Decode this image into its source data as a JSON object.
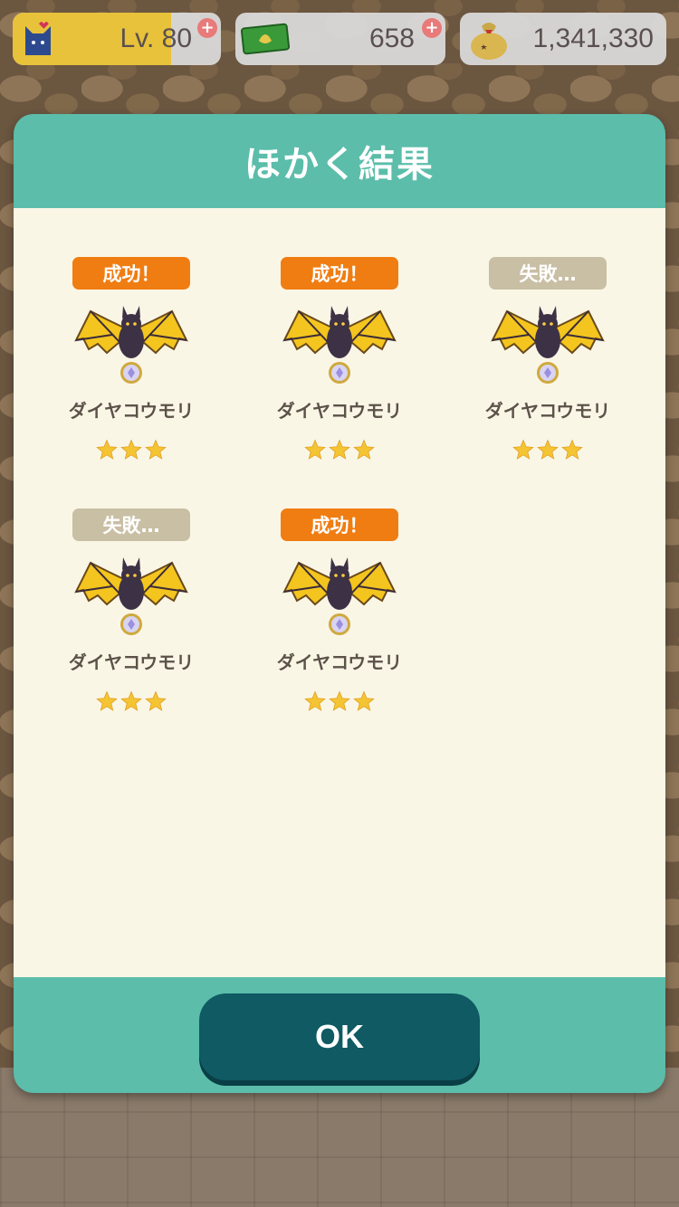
{
  "hud": {
    "level_label": "Lv. 80",
    "level_progress": 0.76,
    "tickets": "658",
    "bells": "1,341,330"
  },
  "dialog": {
    "title": "ほかく結果",
    "items": [
      {
        "result": "成功！",
        "status": "success",
        "name": "ダイヤコウモリ",
        "stars": 3
      },
      {
        "result": "成功！",
        "status": "success",
        "name": "ダイヤコウモリ",
        "stars": 3
      },
      {
        "result": "失敗…",
        "status": "failure",
        "name": "ダイヤコウモリ",
        "stars": 3
      },
      {
        "result": "失敗…",
        "status": "failure",
        "name": "ダイヤコウモリ",
        "stars": 3
      },
      {
        "result": "成功！",
        "status": "success",
        "name": "ダイヤコウモリ",
        "stars": 3
      }
    ],
    "ok_label": "OK"
  },
  "colors": {
    "teal": "#5bbdaa",
    "cream": "#faf6e6",
    "success": "#f07d12",
    "failure": "#c8bfa4",
    "ok_button": "#0f5a63",
    "star": "#f5c433"
  },
  "icons": {
    "level": "cat-icon",
    "tickets": "leaf-ticket-icon",
    "bells": "bell-bag-icon",
    "item": "bat-icon",
    "rating": "star-icon"
  }
}
